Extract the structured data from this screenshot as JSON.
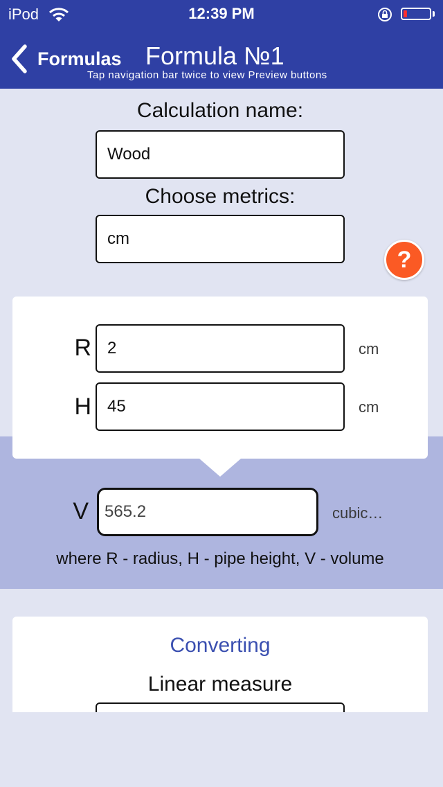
{
  "status_bar": {
    "device": "iPod",
    "time": "12:39 PM",
    "battery_percent": 15
  },
  "nav": {
    "back_label": "Formulas",
    "title": "Formula №1",
    "hint": "Tap navigation bar twice to view Preview buttons"
  },
  "form": {
    "calc_name_label": "Calculation name:",
    "calc_name_value": "Wood",
    "metrics_label": "Choose metrics:",
    "metrics_value": "cm",
    "help_label": "?"
  },
  "params": [
    {
      "letter": "R",
      "value": "2",
      "unit": "cm"
    },
    {
      "letter": "H",
      "value": "45",
      "unit": "cm"
    }
  ],
  "result": {
    "letter": "V",
    "value": "565.2",
    "unit": "cubic…",
    "legend": "where R - radius, H - pipe height, V - volume"
  },
  "converting": {
    "title": "Converting",
    "subtitle": "Linear measure"
  },
  "colors": {
    "nav_bar": "#2f40a4",
    "background": "#e1e4f2",
    "result_band": "#aeb5df",
    "help_button": "#fb5a24",
    "accent_text": "#3a4fb0",
    "battery_low": "#ff2d2d"
  }
}
